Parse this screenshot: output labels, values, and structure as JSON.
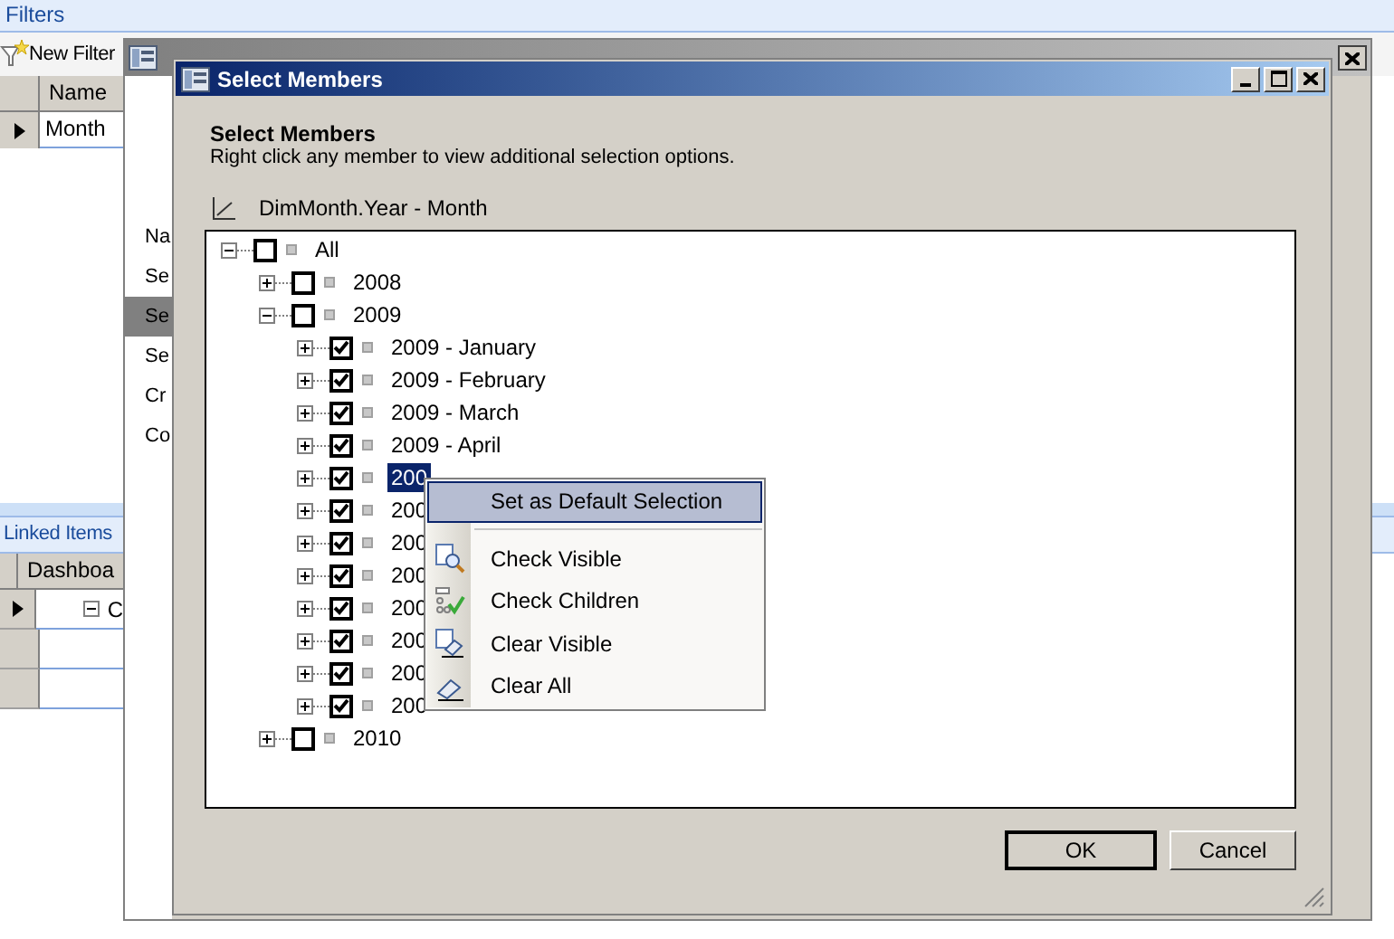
{
  "filters_panel": {
    "title": "Filters",
    "toolbar": {
      "new_filter": "New Filter"
    },
    "columns": [
      "Name"
    ],
    "rows": [
      {
        "name": "Month",
        "selected": true
      }
    ]
  },
  "linked_items": {
    "title": "Linked Items",
    "columns": [
      "Dashboa"
    ],
    "rows": [
      {
        "cell": "C",
        "selected": true,
        "expanded": true
      }
    ]
  },
  "background_window": {
    "nav": [
      {
        "label": "Na",
        "selected": false
      },
      {
        "label": "Se",
        "selected": false
      },
      {
        "label": "Se",
        "selected": true
      },
      {
        "label": "Se",
        "selected": false
      },
      {
        "label": "Cr",
        "selected": false
      },
      {
        "label": "Co",
        "selected": false
      }
    ]
  },
  "dialog": {
    "title": "Select Members",
    "heading": "Select Members",
    "hint": "Right click any member to view additional selection options.",
    "dimension": "DimMonth.Year - Month",
    "tree": [
      {
        "label": "All",
        "checked": false,
        "expanded": true,
        "selected": false,
        "children": [
          {
            "label": "2008",
            "checked": false,
            "expanded": false,
            "selected": false
          },
          {
            "label": "2009",
            "checked": false,
            "expanded": true,
            "selected": false,
            "children": [
              {
                "label": "2009 - January",
                "checked": true,
                "expanded": false,
                "selected": false
              },
              {
                "label": "2009 - February",
                "checked": true,
                "expanded": false,
                "selected": false
              },
              {
                "label": "2009 - March",
                "checked": true,
                "expanded": false,
                "selected": false
              },
              {
                "label": "2009 - April",
                "checked": true,
                "expanded": false,
                "selected": false
              },
              {
                "label": "200",
                "checked": true,
                "expanded": false,
                "selected": true
              },
              {
                "label": "200",
                "checked": true,
                "expanded": false,
                "selected": false
              },
              {
                "label": "200",
                "checked": true,
                "expanded": false,
                "selected": false
              },
              {
                "label": "200",
                "checked": true,
                "expanded": false,
                "selected": false
              },
              {
                "label": "200",
                "checked": true,
                "expanded": false,
                "selected": false
              },
              {
                "label": "200",
                "checked": true,
                "expanded": false,
                "selected": false
              },
              {
                "label": "200",
                "checked": true,
                "expanded": false,
                "selected": false
              },
              {
                "label": "200",
                "checked": true,
                "expanded": false,
                "selected": false
              }
            ]
          },
          {
            "label": "2010",
            "checked": false,
            "expanded": false,
            "selected": false
          }
        ]
      }
    ],
    "buttons": [
      {
        "label": "OK",
        "default": true
      },
      {
        "label": "Cancel",
        "default": false
      }
    ]
  },
  "context_menu": {
    "items": [
      {
        "label": "Set as Default Selection",
        "kind": "header",
        "selected": true
      },
      {
        "label": "Check Visible",
        "kind": "magnifier",
        "selected": false
      },
      {
        "label": "Check Children",
        "kind": "checklist",
        "selected": false
      },
      {
        "label": "Clear Visible",
        "kind": "eraser-pages",
        "selected": false
      },
      {
        "label": "Clear All",
        "kind": "eraser",
        "selected": false
      }
    ]
  }
}
